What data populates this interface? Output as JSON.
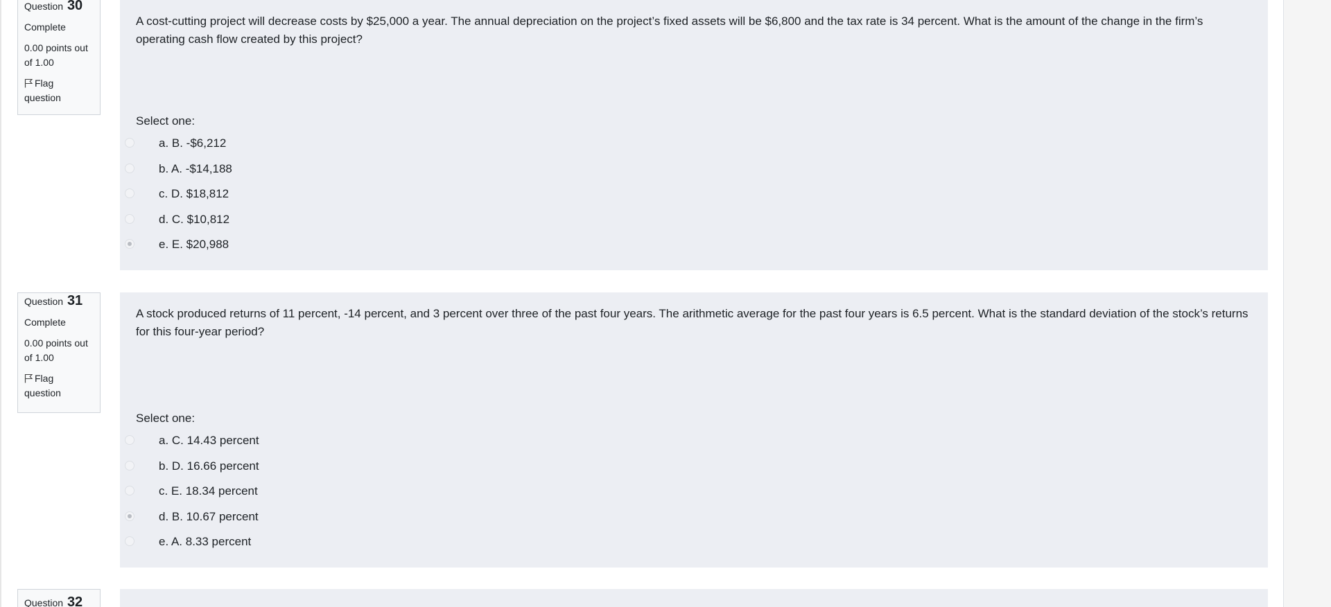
{
  "questions": [
    {
      "word": "Question",
      "number": "30",
      "state": "Complete",
      "grade": "0.00 points out of 1.00",
      "flag": "Flag question",
      "text": "A cost-cutting project will decrease costs by $25,000 a year.  The annual depreciation on the project’s fixed assets will be $6,800 and the tax rate is 34 percent.  What is the amount of the change in the firm’s operating cash flow created by this project?",
      "prompt": "Select one:",
      "answers": [
        {
          "label": "a. B. -$6,212",
          "selected": false
        },
        {
          "label": "b. A. -$14,188",
          "selected": false
        },
        {
          "label": "c. D. $18,812",
          "selected": false
        },
        {
          "label": "d. C. $10,812",
          "selected": false
        },
        {
          "label": "e. E. $20,988",
          "selected": true
        }
      ]
    },
    {
      "word": "Question",
      "number": "31",
      "state": "Complete",
      "grade": "0.00 points out of 1.00",
      "flag": "Flag question",
      "text": "A stock produced returns of 11 percent, -14 percent, and 3 percent over three of the past four years.  The arithmetic average for the past four years is 6.5 percent.  What is the standard deviation of the stock’s returns for this four-year period?",
      "prompt": "Select one:",
      "answers": [
        {
          "label": "a. C. 14.43 percent",
          "selected": false
        },
        {
          "label": "b. D. 16.66 percent",
          "selected": false
        },
        {
          "label": "c. E. 18.34 percent",
          "selected": false
        },
        {
          "label": "d. B. 10.67 percent",
          "selected": true
        },
        {
          "label": "e. A. 8.33 percent",
          "selected": false
        }
      ]
    },
    {
      "word": "Question",
      "number": "32"
    }
  ],
  "colors": {
    "content_bg": "#eceef3",
    "info_bg": "#f8f9fa",
    "info_border": "#cfd4da",
    "text": "#1d2125"
  }
}
